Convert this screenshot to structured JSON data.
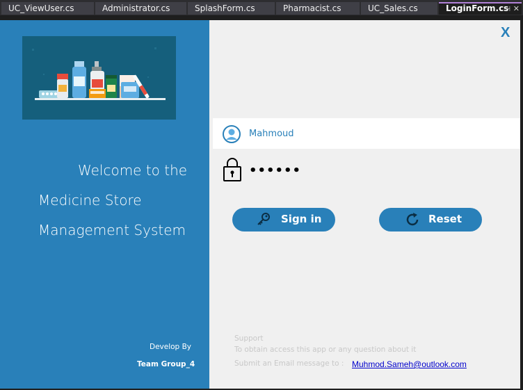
{
  "ide": {
    "tabs": [
      {
        "label": "UC_ViewUser.cs",
        "active": false
      },
      {
        "label": "Administrator.cs",
        "active": false
      },
      {
        "label": "SplashForm.cs",
        "active": false
      },
      {
        "label": "Pharmacist.cs",
        "active": false
      },
      {
        "label": "UC_Sales.cs",
        "active": false
      },
      {
        "label": "LoginForm.cs",
        "active": true
      }
    ],
    "pin_glyph": "⊣",
    "close_glyph": "✕"
  },
  "left_panel": {
    "welcome_lines": [
      "Welcome to the",
      "Medicine Store",
      "Management System"
    ],
    "develop_by": "Develop By",
    "team": "Team Group_4"
  },
  "login": {
    "close_label": "X",
    "username": "Mahmoud",
    "password_mask": "••••••",
    "signin_label": "Sign in",
    "reset_label": "Reset"
  },
  "support": {
    "title": "Support",
    "line1": "To obtain access this app or any question about it",
    "line2": "Submit an Email message to :",
    "email": "Muhmod.Sameh@outlook.com"
  },
  "colors": {
    "brand_blue": "#2980b9",
    "hero_bg": "#155f7c",
    "form_bg": "#f0f0f0"
  },
  "icons": [
    "user-icon",
    "lock-icon",
    "key-icon",
    "refresh-icon",
    "pin-icon",
    "close-icon"
  ]
}
